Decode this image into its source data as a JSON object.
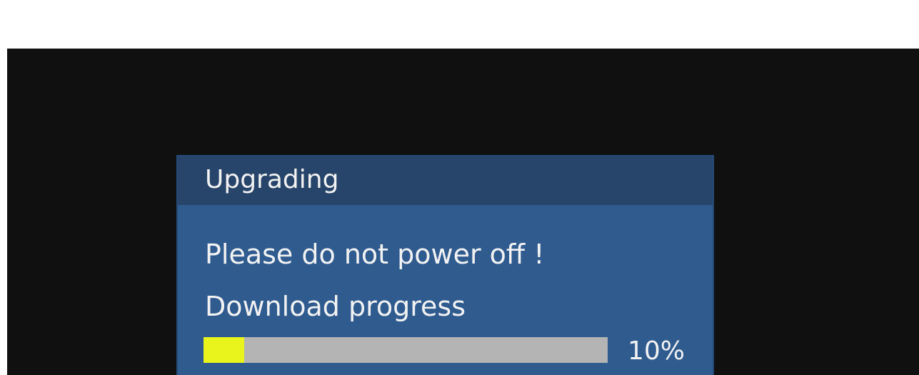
{
  "dialog": {
    "title": "Upgrading",
    "warning": "Please do not power off !",
    "progress_label": "Download progress",
    "progress_value": 0.1,
    "progress_text": "10%"
  },
  "colors": {
    "page_background": "#ffffff",
    "screen_background": "#101010",
    "dialog_background": "#2f5b8f",
    "header_background": "#27456a",
    "text": "#f2f2f2",
    "progress_track": "#b4b4b4",
    "progress_fill": "#e8f41c"
  }
}
